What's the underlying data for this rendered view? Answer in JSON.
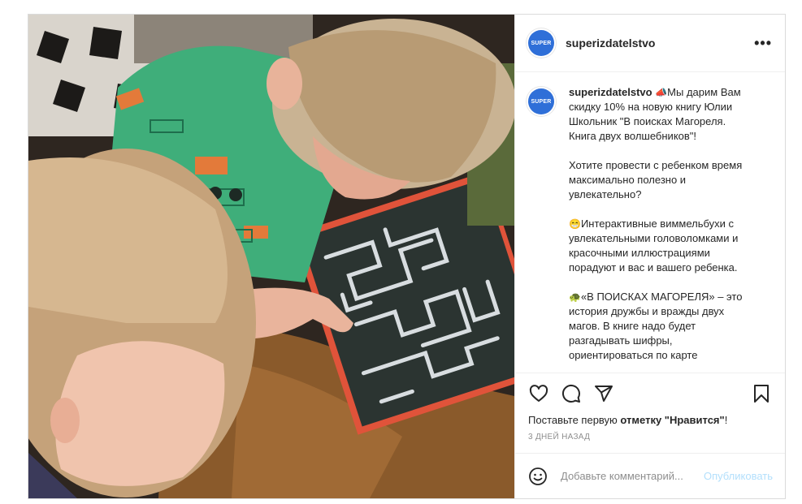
{
  "post": {
    "account": {
      "username": "superizdatelstvo",
      "avatar_text": "SUPER",
      "avatar_color": "#2f6fd8"
    },
    "header": {
      "more_icon": "more-horizontal-icon"
    },
    "photo": {
      "description_icon": "post-photo"
    },
    "caption": {
      "username": "superizdatelstvo",
      "paragraphs": [
        {
          "emoji": "📣",
          "text": "Мы дарим Вам скидку 10% на новую книгу Юлии Школьник \"В поисках Магореля. Книга двух волшебников\"!"
        },
        {
          "emoji": "",
          "text": "Хотите провести с ребенком время максимально полезно и увлекательно?"
        },
        {
          "emoji": "😁",
          "text": "Интерактивные виммельбухи с увлекательными головоломками и красочными иллюстрациями порадуют и вас и вашего ребенка."
        },
        {
          "emoji": "🐢",
          "text": "«В ПОИСКАХ МАГОРЕЛЯ» – это история дружбы и вражды двух магов. В книге надо будет разгадывать шифры, ориентироваться по карте"
        }
      ]
    },
    "actions": {
      "like_icon": "heart-icon",
      "comment_icon": "comment-icon",
      "share_icon": "share-icon",
      "save_icon": "bookmark-icon"
    },
    "likes": {
      "prefix": "Поставьте первую ",
      "bold": "отметку \"Нравится\"",
      "suffix": "!"
    },
    "time": "3 ДНЕЙ НАЗАД",
    "comment": {
      "placeholder": "Добавьте комментарий...",
      "publish_label": "Опубликовать",
      "publish_color": "#b2dffc",
      "emoji_icon": "smile-icon"
    }
  }
}
